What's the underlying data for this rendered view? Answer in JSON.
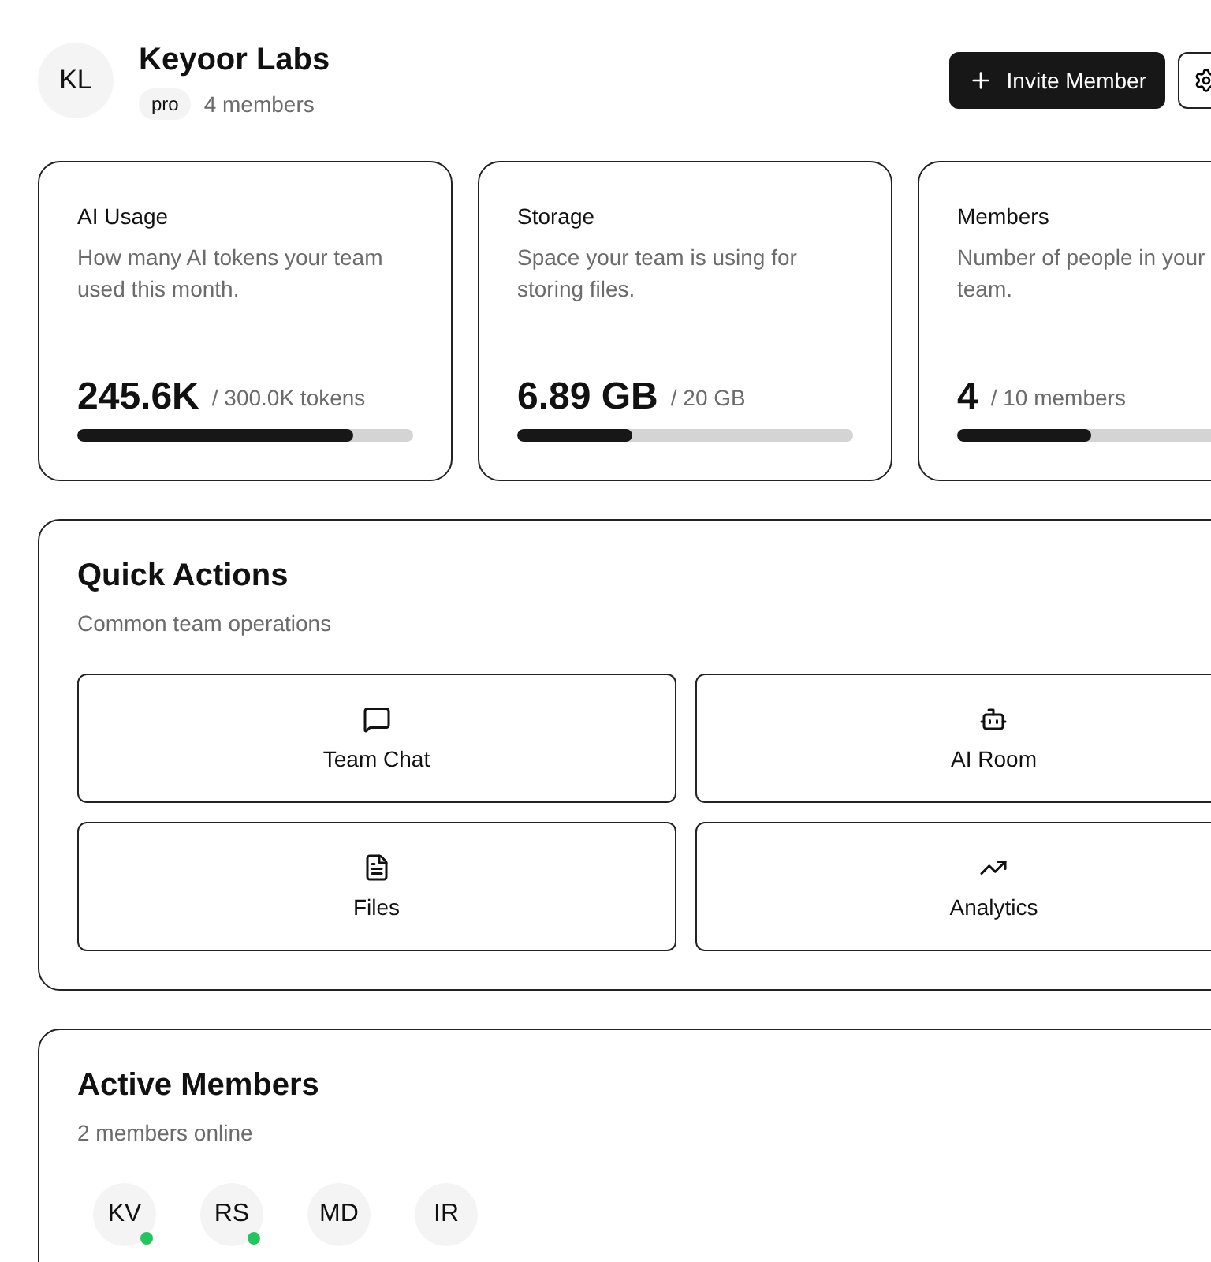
{
  "team": {
    "initials": "KL",
    "name": "Keyoor Labs",
    "plan": "pro",
    "member_count": "4 members"
  },
  "actions": {
    "invite": "Invite Member"
  },
  "stats": [
    {
      "title": "AI Usage",
      "description": "How many AI tokens your team used this month.",
      "value": "245.6K",
      "limit": "/ 300.0K tokens",
      "level": 0.82
    },
    {
      "title": "Storage",
      "description": "Space your team is using for storing files.",
      "value": "6.89 GB",
      "limit": "/ 20 GB",
      "level": 0.345
    },
    {
      "title": "Members",
      "description": "Number of people in your team.",
      "value": "4",
      "limit": "/ 10 members",
      "level": 0.4
    }
  ],
  "quick_actions": {
    "title": "Quick Actions",
    "subtitle": "Common team operations",
    "items": [
      {
        "label": "Team Chat",
        "kind": "chat"
      },
      {
        "label": "AI Room",
        "kind": "bot"
      },
      {
        "label": "Files",
        "kind": "file"
      },
      {
        "label": "Analytics",
        "kind": "trend"
      }
    ]
  },
  "active_members": {
    "title": "Active Members",
    "subtitle": "2 members online",
    "members": [
      {
        "initials": "KV",
        "online": true
      },
      {
        "initials": "RS",
        "online": true
      },
      {
        "initials": "MD",
        "online": false
      },
      {
        "initials": "IR",
        "online": false
      }
    ]
  }
}
